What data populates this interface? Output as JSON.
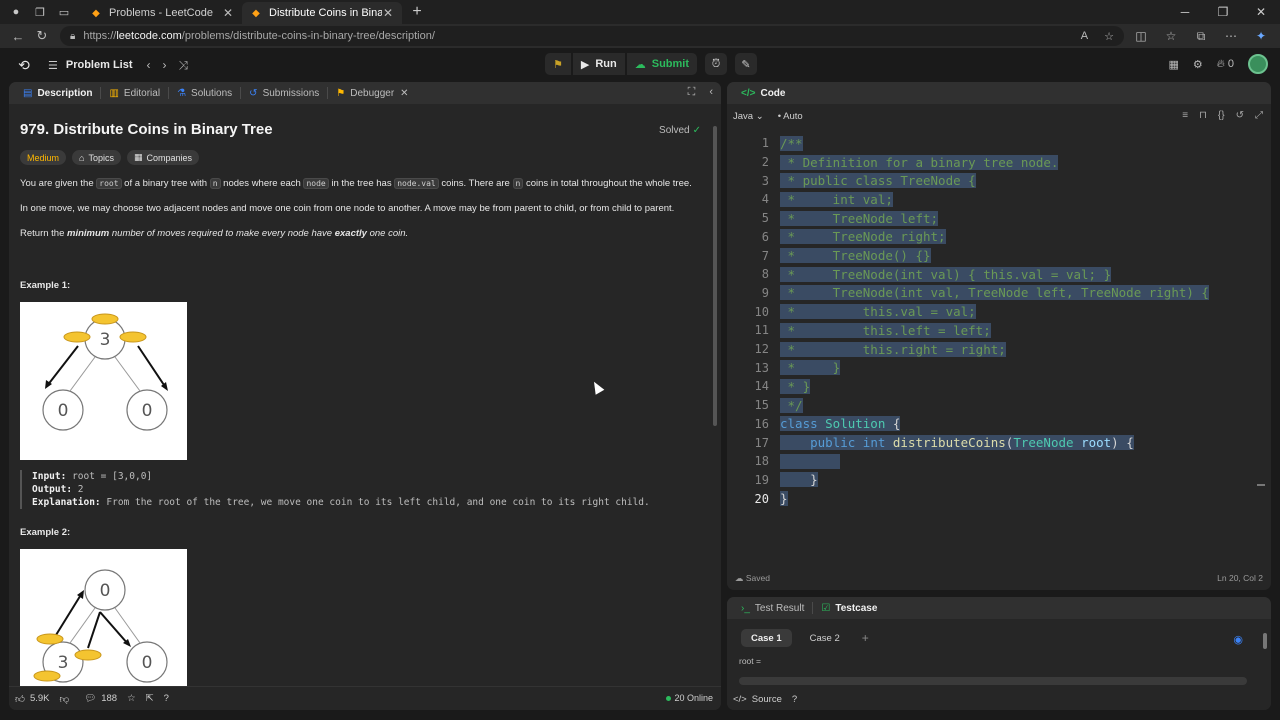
{
  "browser": {
    "tabs": [
      {
        "label": "Problems - LeetCode",
        "active": false
      },
      {
        "label": "Distribute Coins in Binary Tree - L",
        "active": true
      }
    ],
    "url_scheme": "https://",
    "url_domain": "leetcode.com",
    "url_path": "/problems/distribute-coins-in-binary-tree/description/"
  },
  "nav": {
    "problem_list": "Problem List",
    "run": "Run",
    "submit": "Submit",
    "streak": "0"
  },
  "left": {
    "tabs": [
      "Description",
      "Editorial",
      "Solutions",
      "Submissions",
      "Debugger"
    ],
    "title": "979. Distribute Coins in Binary Tree",
    "solved": "Solved",
    "difficulty": "Medium",
    "topics": "Topics",
    "companies": "Companies",
    "para1": {
      "a": "You are given the ",
      "c1": "root",
      "b": " of a binary tree with ",
      "c2": "n",
      "c": " nodes where each ",
      "c3": "node",
      "d": " in the tree has ",
      "c4": "node.val",
      "e": " coins. There are ",
      "c5": "n",
      "f": " coins in total throughout the whole tree."
    },
    "para2": "In one move, we may choose two adjacent nodes and move one coin from one node to another. A move may be from parent to child, or from child to parent.",
    "para3": {
      "a": "Return the ",
      "b": "minimum",
      "c": " number of moves required to make every node have ",
      "d": "exactly",
      "e": " one coin."
    },
    "example1_title": "Example 1:",
    "example1": {
      "input_label": "Input:",
      "input": "root = [3,0,0]",
      "output_label": "Output:",
      "output": "2",
      "explanation_label": "Explanation:",
      "explanation": "From the root of the tree, we move one coin to its left child, and one coin to its right child."
    },
    "example2_title": "Example 2:",
    "img1_nodes": [
      "3",
      "0",
      "0"
    ],
    "img2_nodes": [
      "0",
      "3",
      "0"
    ],
    "likes": "5.9K",
    "comments": "188",
    "online": "20 Online"
  },
  "code": {
    "tab": "Code",
    "language": "Java",
    "mode": "Auto",
    "saved": "Saved",
    "cursor_pos": "Ln 20, Col 2",
    "current_line": 20
  },
  "test": {
    "tabs": [
      "Test Result",
      "Testcase"
    ],
    "cases": [
      "Case 1",
      "Case 2"
    ],
    "root_label": "root =",
    "source": "Source"
  },
  "colors": {
    "accent_green": "#2cbb5d",
    "medium": "#ffb800",
    "selection": "#3a4b63"
  }
}
